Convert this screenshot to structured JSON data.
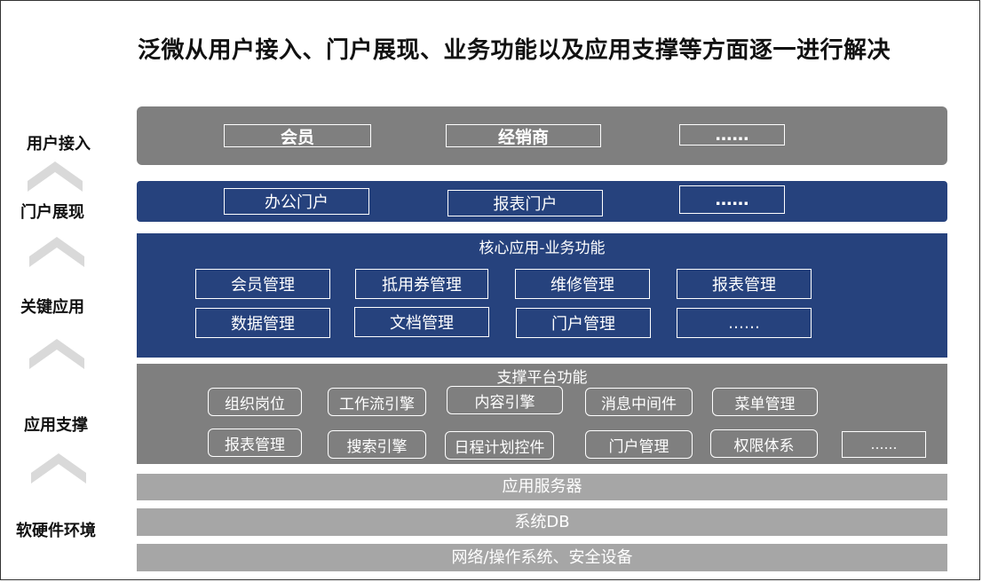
{
  "title": "泛微从用户接入、门户展现、业务功能以及应用支撑等方面逐一进行解决",
  "side_labels": [
    "用户接入",
    "门户展现",
    "关键应用",
    "应用支撑",
    "软硬件环境"
  ],
  "user_access": {
    "items": [
      "会员",
      "经销商",
      "……"
    ]
  },
  "portal": {
    "items": [
      "办公门户",
      "报表门户",
      "……"
    ]
  },
  "core": {
    "title": "核心应用-业务功能",
    "items": [
      "会员管理",
      "抵用券管理",
      "维修管理",
      "报表管理",
      "数据管理",
      "文档管理",
      "门户管理",
      "……"
    ]
  },
  "support": {
    "title": "支撑平台功能",
    "items": [
      "组织岗位",
      "工作流引擎",
      "内容引擎",
      "消息中间件",
      "菜单管理",
      "报表管理",
      "搜索引擎",
      "日程计划控件",
      "门户管理",
      "权限体系",
      "……"
    ]
  },
  "infra": {
    "items": [
      "应用服务器",
      "系统DB",
      "网络/操作系统、安全设备"
    ]
  },
  "colors": {
    "gray_band": "#7f7f7f",
    "blue_band": "#26427d",
    "light_band": "#a6a6a6",
    "chevron": "#d9d9d9"
  }
}
